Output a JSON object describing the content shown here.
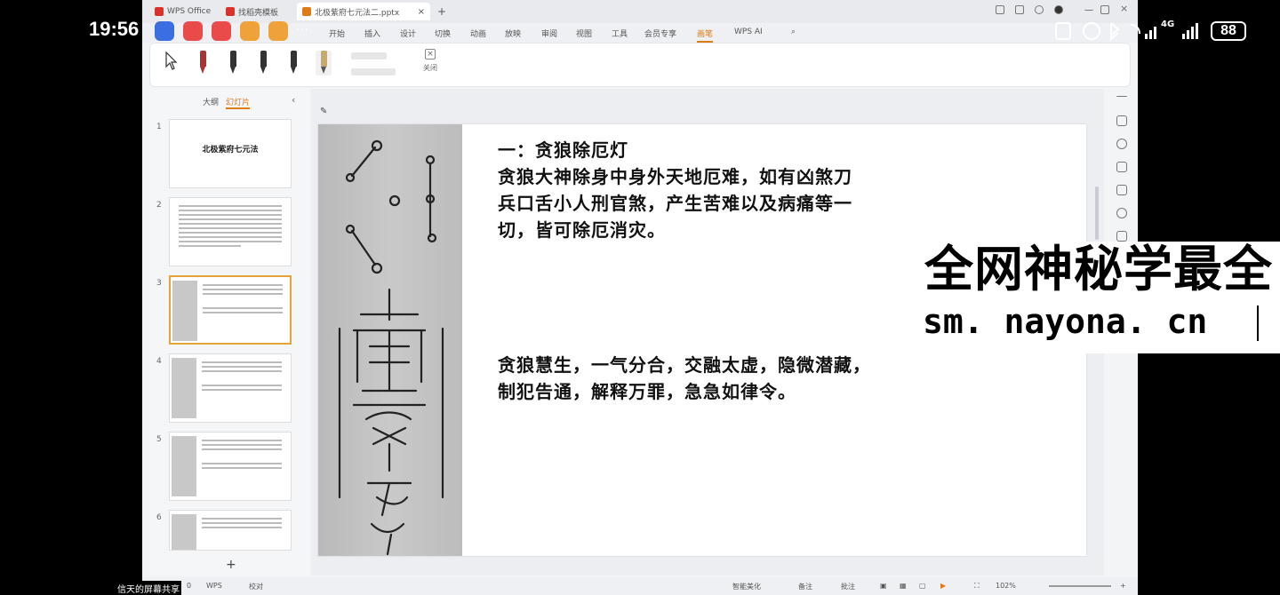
{
  "phone": {
    "time": "19:56",
    "battery": "88",
    "network": "4G",
    "overflow": "···"
  },
  "wps": {
    "tabs": [
      {
        "label": "WPS Office",
        "color": "#d9322c"
      },
      {
        "label": "找稻壳模板",
        "color": "#d9322c"
      },
      {
        "label": "北极紫府七元法二.pptx",
        "color": "#e07a17"
      }
    ],
    "new_tab": "+",
    "menu": [
      "开始",
      "插入",
      "设计",
      "切换",
      "动画",
      "放映",
      "审阅",
      "视图",
      "工具",
      "会员专享",
      "画笔",
      "WPS AI"
    ],
    "active_menu": "画笔",
    "toolbar": {
      "close_label": "关闭"
    },
    "pane": {
      "tab_outline": "大纲",
      "tab_slides": "幻灯片",
      "add": "+"
    },
    "slides": [
      {
        "num": "1",
        "title": "北极紫府七元法"
      },
      {
        "num": "2"
      },
      {
        "num": "3"
      },
      {
        "num": "4"
      },
      {
        "num": "5"
      },
      {
        "num": "6"
      }
    ],
    "slide": {
      "heading": "一：贪狼除厄灯",
      "para1_line1": "贪狼大神除身中身外天地厄难，如有凶煞刀",
      "para1_line2": "兵口舌小人刑官煞，产生苦难以及病痛等一",
      "para1_line3": "切，皆可除厄消灾。",
      "para2_line1": "贪狼慧生，一气分合，交融太虚，隐微潜藏，",
      "para2_line2": "制犯告通，解释万罪，急急如律令。"
    },
    "status": {
      "slide_counter": "0",
      "wps": "WPS",
      "proof": "校对",
      "beautify": "智能美化",
      "notes": "备注",
      "comments": "批注",
      "zoom": "102%"
    }
  },
  "overlay": {
    "watermark_title": "全网神秘学最全",
    "watermark_url": "sm. nayona. cn",
    "share_label": "信天的屏幕共享"
  }
}
